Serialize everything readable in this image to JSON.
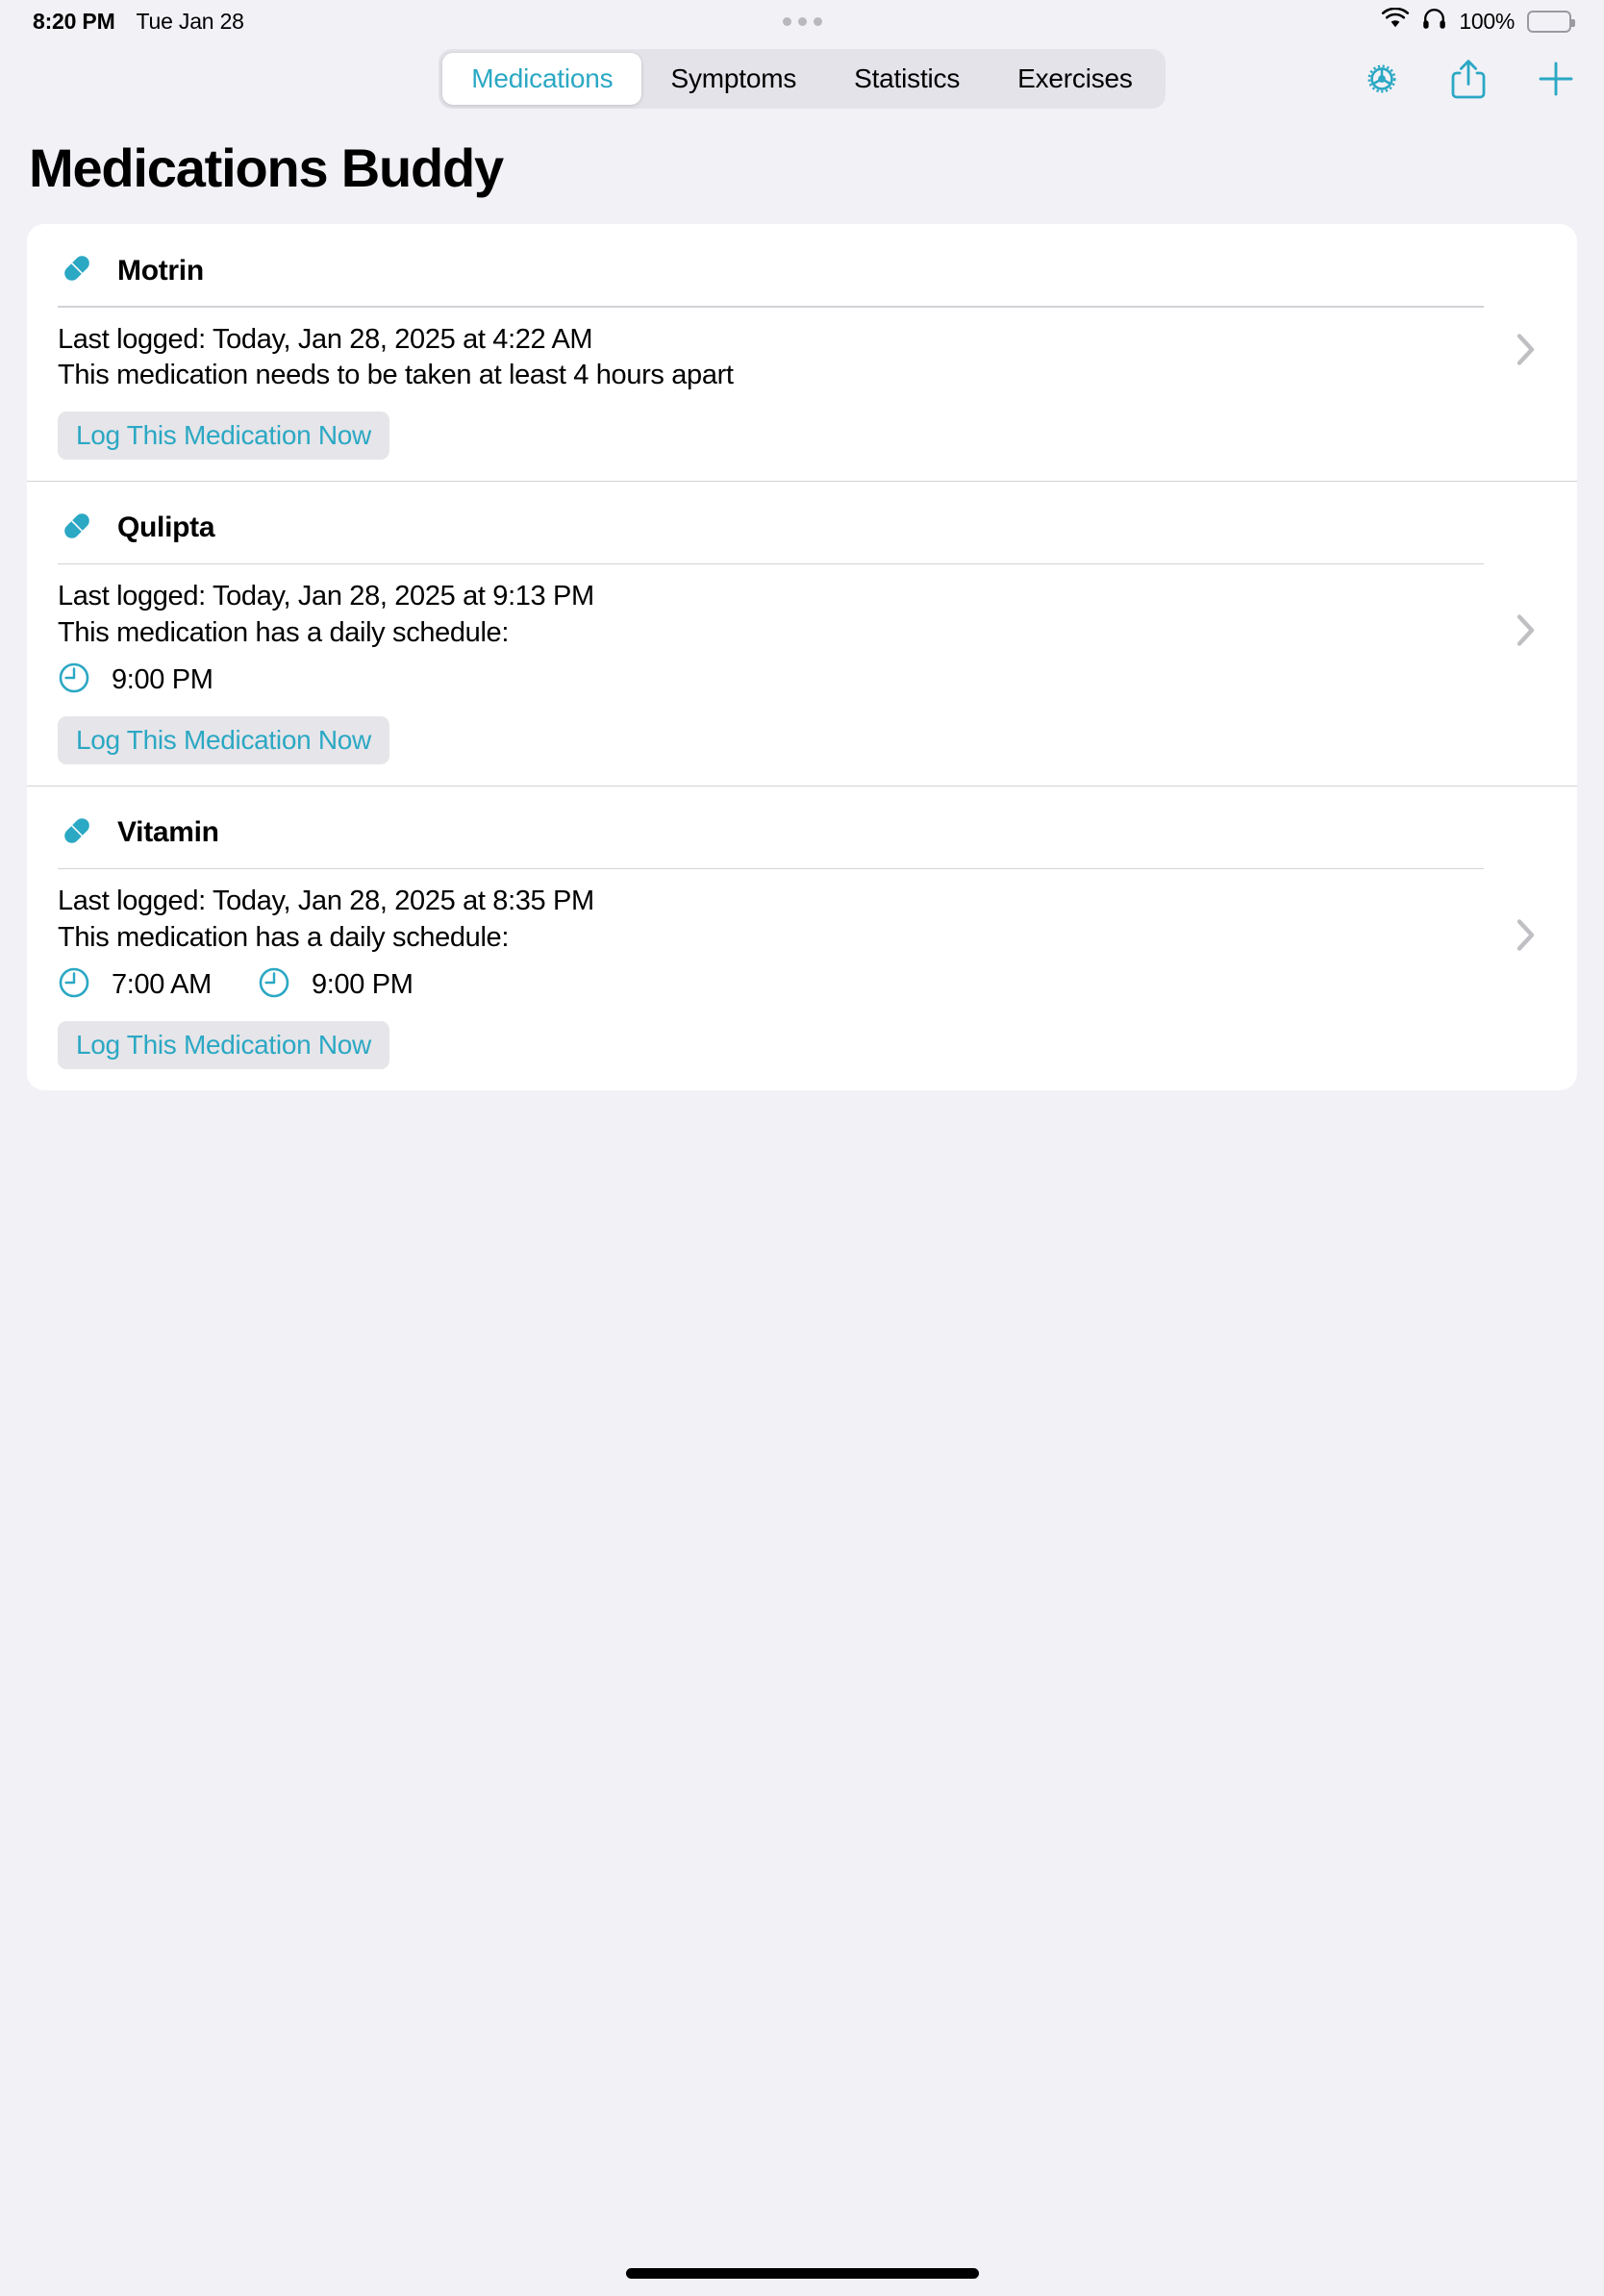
{
  "status_bar": {
    "time": "8:20 PM",
    "date": "Tue Jan 28",
    "battery_percent": "100%",
    "wifi_icon": "wifi-icon",
    "headphones_icon": "headphones-icon",
    "battery_icon": "battery-full-icon",
    "multitask_icon": "multitasking-dots-icon"
  },
  "toolbar": {
    "tabs": [
      {
        "label": "Medications",
        "active": true
      },
      {
        "label": "Symptoms",
        "active": false
      },
      {
        "label": "Statistics",
        "active": false
      },
      {
        "label": "Exercises",
        "active": false
      }
    ],
    "icons": [
      {
        "name": "gear-icon",
        "label": "Settings"
      },
      {
        "name": "share-icon",
        "label": "Share"
      },
      {
        "name": "plus-icon",
        "label": "Add"
      }
    ]
  },
  "page": {
    "title": "Medications Buddy"
  },
  "colors": {
    "accent": "#2ba8c4",
    "background": "#f2f1f6",
    "card": "#ffffff",
    "button_bg": "#e6e5e9",
    "divider": "#d3d2d7",
    "chevron": "#c0c0c4"
  },
  "medications": [
    {
      "name": "Motrin",
      "icon": "pill-icon",
      "last_logged": "Last logged: Today, Jan 28, 2025 at 4:22 AM",
      "note": "This medication needs to be taken at least 4 hours apart",
      "schedule_times": [],
      "log_button": "Log This Medication Now",
      "disclosure_icon": "chevron-right-icon"
    },
    {
      "name": "Qulipta",
      "icon": "pill-icon",
      "last_logged": "Last logged: Today, Jan 28, 2025 at 9:13 PM",
      "note": "This medication has a daily schedule:",
      "schedule_times": [
        "9:00 PM"
      ],
      "log_button": "Log This Medication Now",
      "disclosure_icon": "chevron-right-icon"
    },
    {
      "name": "Vitamin",
      "icon": "pill-icon",
      "last_logged": "Last logged: Today, Jan 28, 2025 at 8:35 PM",
      "note": "This medication has a daily schedule:",
      "schedule_times": [
        "7:00 AM",
        "9:00 PM"
      ],
      "log_button": "Log This Medication Now",
      "disclosure_icon": "chevron-right-icon"
    }
  ]
}
